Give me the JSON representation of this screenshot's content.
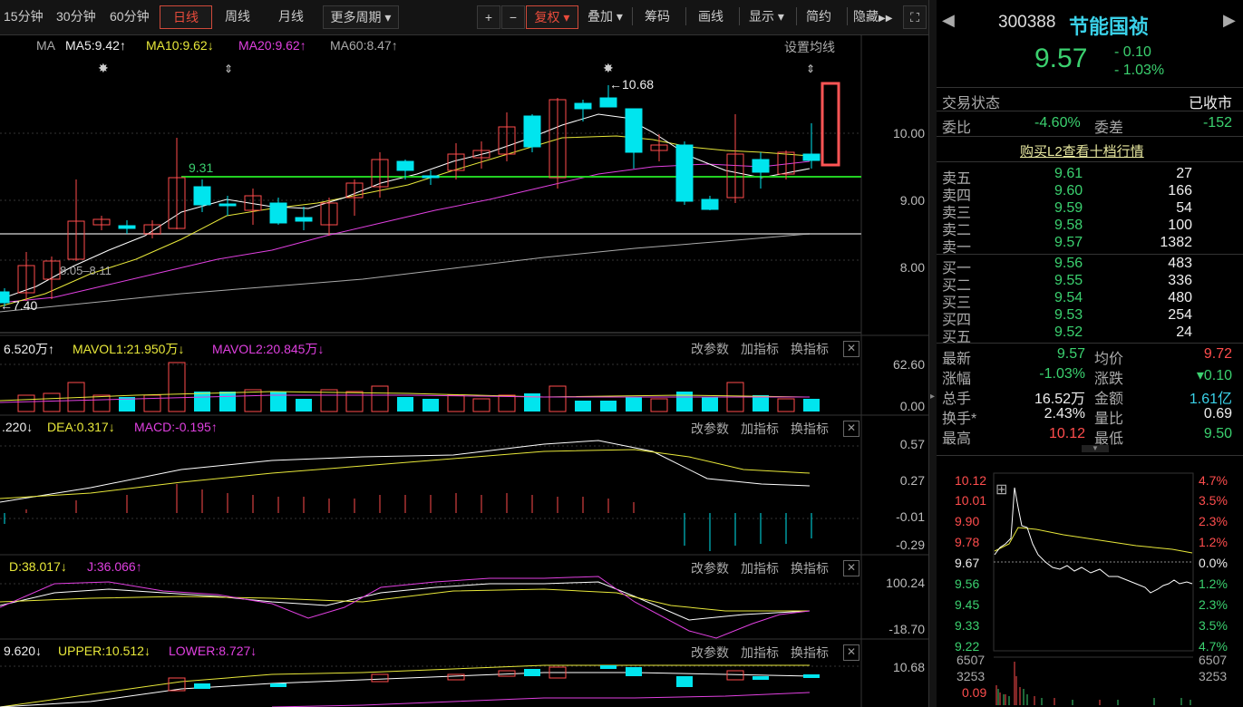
{
  "toolbar": {
    "period_tabs": [
      "15分钟",
      "30分钟",
      "60分钟",
      "日线",
      "周线",
      "月线",
      "更多周期"
    ],
    "plus": "+",
    "minus": "−",
    "adjust_label": "复权",
    "overlay_label": "叠加",
    "chips_label": "筹码",
    "draw_label": "画线",
    "display_label": "显示",
    "simple_label": "简约",
    "hide_label": "隐藏"
  },
  "main_pane": {
    "ma_label": "MA",
    "ma5": "MA5:9.42",
    "ma10": "MA10:9.62",
    "ma20": "MA20:9.62",
    "ma60": "MA60:8.47",
    "settings_label": "设置均线",
    "high_mark": "10.68",
    "low_mark": "7.40",
    "line_label": "9.31",
    "range_label": "8.05–8.11",
    "y_ticks": [
      "10.00",
      "9.00",
      "8.00"
    ]
  },
  "vol_pane": {
    "vol": "6.520万",
    "mavol1": "MAVOL1:21.950万",
    "mavol2": "MAVOL2:20.845万",
    "y_ticks": [
      "62.60",
      "0.00"
    ]
  },
  "macd_pane": {
    "dif": ".220",
    "dea": "DEA:0.317",
    "macd": "MACD:-0.195",
    "y_ticks": [
      "0.57",
      "0.27",
      "-0.01",
      "-0.29"
    ]
  },
  "kdj_pane": {
    "d": "D:38.017",
    "j": "J:36.066",
    "y_ticks": [
      "100.24",
      "-18.70"
    ]
  },
  "boll_pane": {
    "mid": "9.620",
    "upper": "UPPER:10.512",
    "lower": "LOWER:8.727",
    "y_ticks": [
      "10.68"
    ]
  },
  "pane_buttons": {
    "modify": "改参数",
    "add": "加指标",
    "swap": "换指标",
    "close": "✕"
  },
  "quote": {
    "code": "300388",
    "name": "节能国祯",
    "price": "9.57",
    "change": "- 0.10",
    "change_pct": "- 1.03%",
    "status_label": "交易状态",
    "status_value": "已收市",
    "weibi_label": "委比",
    "weibi_value": "-4.60%",
    "weicha_label": "委差",
    "weicha_value": "-152",
    "l2_link": "购买L2查看十档行情",
    "asks": [
      {
        "label": "卖五",
        "price": "9.61",
        "vol": "27"
      },
      {
        "label": "卖四",
        "price": "9.60",
        "vol": "166"
      },
      {
        "label": "卖三",
        "price": "9.59",
        "vol": "54"
      },
      {
        "label": "卖二",
        "price": "9.58",
        "vol": "100"
      },
      {
        "label": "卖一",
        "price": "9.57",
        "vol": "1382"
      }
    ],
    "bids": [
      {
        "label": "买一",
        "price": "9.56",
        "vol": "483"
      },
      {
        "label": "买二",
        "price": "9.55",
        "vol": "336"
      },
      {
        "label": "买三",
        "price": "9.54",
        "vol": "480"
      },
      {
        "label": "买四",
        "price": "9.53",
        "vol": "254"
      },
      {
        "label": "买五",
        "price": "9.52",
        "vol": "24"
      }
    ],
    "stats": [
      {
        "l1": "最新",
        "v1": "9.57",
        "l2": "均价",
        "v2": "9.72"
      },
      {
        "l1": "涨幅",
        "v1": "-1.03%",
        "l2": "涨跌",
        "v2": "▾0.10"
      },
      {
        "l1": "总手",
        "v1": "16.52万",
        "l2": "金额",
        "v2": "1.61亿"
      },
      {
        "l1": "换手*",
        "v1": "2.43%",
        "l2": "量比",
        "v2": "0.69"
      },
      {
        "l1": "最高",
        "v1": "10.12",
        "l2": "最低",
        "v2": "9.50"
      }
    ]
  },
  "intraday": {
    "left_ticks": [
      "10.12",
      "10.01",
      "9.90",
      "9.78",
      "9.67",
      "9.56",
      "9.45",
      "9.33",
      "9.22"
    ],
    "right_ticks": [
      "4.7%",
      "3.5%",
      "2.3%",
      "1.2%",
      "0.0%",
      "1.2%",
      "2.3%",
      "3.5%",
      "4.7%"
    ],
    "vol_left": [
      "6507",
      "3253",
      "0.09"
    ],
    "vol_right": [
      "6507",
      "3253"
    ]
  },
  "colors": {
    "up": "#ff4d4d",
    "down": "#00e5ee",
    "ma5": "#ffffff",
    "ma10": "#e8e83a",
    "ma20": "#e040e0",
    "ma60": "#aaaaaa",
    "hline": "#22d022"
  }
}
